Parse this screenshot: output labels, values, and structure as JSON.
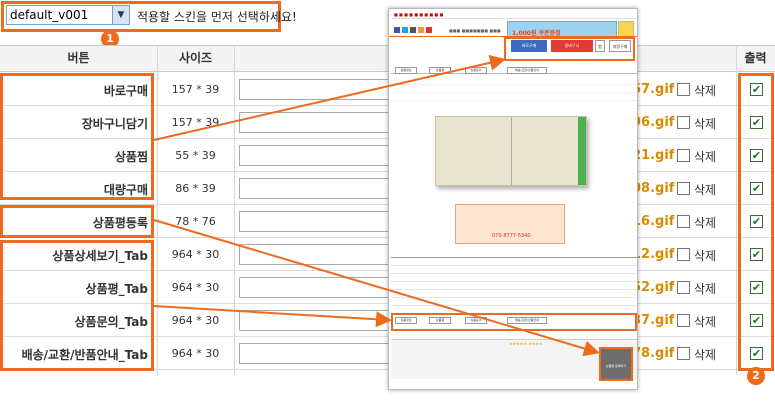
{
  "skin_select": {
    "value": "default_v001",
    "hint": "적용할 스킨을 먼저 선택하세요!"
  },
  "badges": [
    "1",
    "2"
  ],
  "columns": {
    "button": "버튼",
    "size": "사이즈",
    "output": "출력"
  },
  "rows": [
    {
      "name": "바로구매",
      "size": "157 * 39",
      "file": "67.gif",
      "delete": "삭제",
      "checked": true
    },
    {
      "name": "장바구니담기",
      "size": "157 * 39",
      "file": "96.gif",
      "delete": "삭제",
      "checked": true
    },
    {
      "name": "상품찜",
      "size": "55 * 39",
      "file": "21.gif",
      "delete": "삭제",
      "checked": true
    },
    {
      "name": "대량구매",
      "size": "86 * 39",
      "file": "08.gif",
      "delete": "삭제",
      "checked": true
    },
    {
      "name": "상품평등록",
      "size": "78 * 76",
      "file": "16.gif",
      "delete": "삭제",
      "checked": true
    },
    {
      "name": "상품상세보기_Tab",
      "size": "964 * 30",
      "file": "12.gif",
      "delete": "삭제",
      "checked": true
    },
    {
      "name": "상품평_Tab",
      "size": "964 * 30",
      "file": "52.gif",
      "delete": "삭제",
      "checked": true
    },
    {
      "name": "상품문의_Tab",
      "size": "964 * 30",
      "file": "37.gif",
      "delete": "삭제",
      "checked": true
    },
    {
      "name": "배송/교환/반품안내_Tab",
      "size": "964 * 30",
      "file": "78.gif",
      "delete": "삭제",
      "checked": true
    }
  ],
  "preview": {
    "banner": "1,000원 쿠폰증정",
    "buy_btn": "바로구매",
    "cart_btn": "장바구니",
    "wish_btn": "찜",
    "bulk_btn": "대량구매",
    "tabs": [
      "상품정보",
      "상품평",
      "상품문의",
      "배송/교환/반품안내"
    ],
    "notice_phone": "070-8777-5340",
    "review_btn": "상품평 등록하기"
  }
}
